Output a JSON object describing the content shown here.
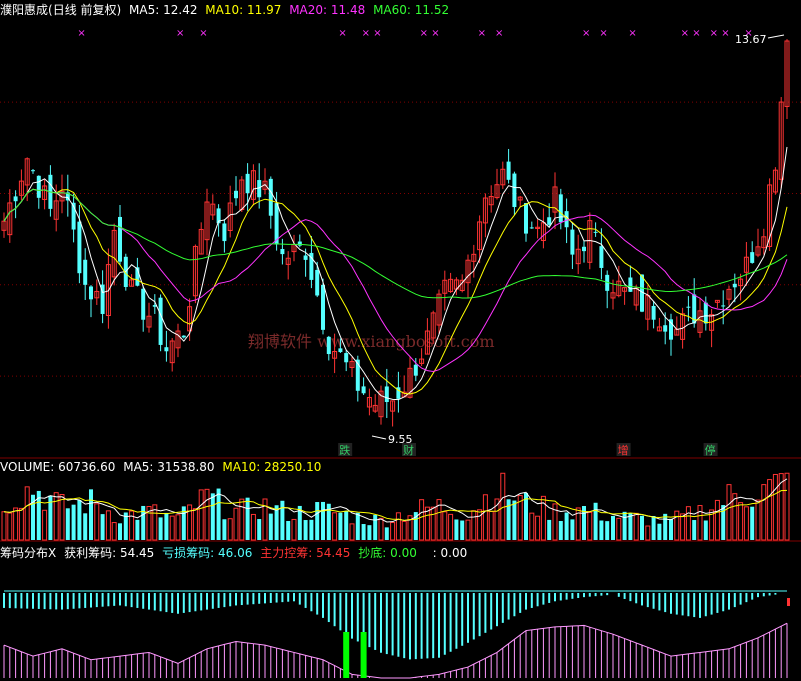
{
  "header": {
    "stock_name": "濮阳惠成",
    "period": "(日线 前复权)",
    "ma5_label": "MA5:",
    "ma5_value": "12.42",
    "ma10_label": "MA10:",
    "ma10_value": "11.97",
    "ma20_label": "MA20:",
    "ma20_value": "11.48",
    "ma60_label": "MA60:",
    "ma60_value": "11.52"
  },
  "volume_header": {
    "label": "VOLUME:",
    "value": "60736.60",
    "ma5_label": "MA5:",
    "ma5_value": "31538.80",
    "ma10_label": "MA10:",
    "ma10_value": "28250.10"
  },
  "chip_header": {
    "label": "筹码分布X",
    "profit_label": "获利筹码:",
    "profit_value": "54.45",
    "loss_label": "亏损筹码:",
    "loss_value": "46.06",
    "control_label": "主力控筹:",
    "control_value": "54.45",
    "bottom_label": "抄底:",
    "bottom_value": "0.00",
    "extra_label": ":",
    "extra_value": "0.00"
  },
  "annotations": {
    "high_price": "13.67",
    "low_price": "9.55",
    "watermark": "翔博软件 www.xiangbosoft.com"
  },
  "signals": [
    {
      "text": "跌",
      "index": 59,
      "color": "#33cc66"
    },
    {
      "text": "财",
      "index": 70,
      "color": "#33cc66"
    },
    {
      "text": "增",
      "index": 107,
      "color": "#ff3333"
    },
    {
      "text": "停",
      "index": 122,
      "color": "#33cc66"
    }
  ],
  "colors": {
    "up": "#ff3333",
    "down": "#55ffff",
    "ma5": "#ffffff",
    "ma10": "#ffff00",
    "ma20": "#ff33ff",
    "ma60": "#33ff33",
    "grid": "#800000",
    "header_text": "#ffffff",
    "ma10_text": "#ffff00",
    "ma20_text": "#ff33ff",
    "ma60_text": "#33ff33",
    "chip_label": "#ffffff",
    "profit": "#ffffff",
    "loss": "#55ffff",
    "control": "#ff3333",
    "bottom": "#33ff33",
    "chip_cyan": "#55ffff",
    "chip_pink": "#ff99ff",
    "chip_green": "#00ff00"
  },
  "chart_data": {
    "type": "candlestick",
    "price_range": [
      9.3,
      13.9
    ],
    "close_anchors": [
      [
        0,
        11.7
      ],
      [
        4,
        12.4
      ],
      [
        8,
        11.8
      ],
      [
        10,
        12.1
      ],
      [
        14,
        11.0
      ],
      [
        17,
        10.8
      ],
      [
        19,
        11.6
      ],
      [
        22,
        10.9
      ],
      [
        26,
        10.6
      ],
      [
        28,
        10.3
      ],
      [
        31,
        10.5
      ],
      [
        35,
        12.0
      ],
      [
        38,
        11.6
      ],
      [
        41,
        12.2
      ],
      [
        45,
        12.0
      ],
      [
        48,
        11.3
      ],
      [
        52,
        11.4
      ],
      [
        56,
        10.4
      ],
      [
        59,
        10.1
      ],
      [
        61,
        9.9
      ],
      [
        64,
        9.7
      ],
      [
        67,
        9.75
      ],
      [
        70,
        10.0
      ],
      [
        73,
        10.4
      ],
      [
        76,
        10.9
      ],
      [
        79,
        11.0
      ],
      [
        83,
        12.0
      ],
      [
        86,
        12.2
      ],
      [
        89,
        11.8
      ],
      [
        92,
        11.6
      ],
      [
        95,
        11.9
      ],
      [
        98,
        11.3
      ],
      [
        101,
        11.6
      ],
      [
        104,
        11.1
      ],
      [
        107,
        10.9
      ],
      [
        110,
        10.8
      ],
      [
        113,
        10.7
      ],
      [
        116,
        10.5
      ],
      [
        119,
        10.7
      ],
      [
        122,
        10.75
      ],
      [
        125,
        11.0
      ],
      [
        128,
        11.2
      ],
      [
        131,
        11.7
      ],
      [
        133,
        12.4
      ],
      [
        135,
        13.67
      ]
    ],
    "volume_anchors": [
      [
        0,
        40
      ],
      [
        5,
        55
      ],
      [
        10,
        35
      ],
      [
        15,
        40
      ],
      [
        20,
        25
      ],
      [
        25,
        30
      ],
      [
        30,
        22
      ],
      [
        35,
        45
      ],
      [
        40,
        30
      ],
      [
        45,
        35
      ],
      [
        50,
        28
      ],
      [
        55,
        32
      ],
      [
        60,
        25
      ],
      [
        65,
        20
      ],
      [
        70,
        30
      ],
      [
        75,
        35
      ],
      [
        80,
        28
      ],
      [
        85,
        55
      ],
      [
        90,
        38
      ],
      [
        95,
        30
      ],
      [
        100,
        32
      ],
      [
        105,
        25
      ],
      [
        110,
        22
      ],
      [
        115,
        20
      ],
      [
        120,
        30
      ],
      [
        125,
        45
      ],
      [
        130,
        50
      ],
      [
        135,
        60.7
      ]
    ],
    "chip_cyan_anchors": [
      [
        0,
        0.18
      ],
      [
        10,
        0.2
      ],
      [
        20,
        0.15
      ],
      [
        30,
        0.25
      ],
      [
        40,
        0.15
      ],
      [
        50,
        0.1
      ],
      [
        55,
        0.3
      ],
      [
        60,
        0.55
      ],
      [
        65,
        0.72
      ],
      [
        70,
        0.8
      ],
      [
        75,
        0.78
      ],
      [
        80,
        0.6
      ],
      [
        85,
        0.4
      ],
      [
        90,
        0.2
      ],
      [
        95,
        0.1
      ],
      [
        100,
        0.05
      ],
      [
        105,
        0.02
      ],
      [
        110,
        0.15
      ],
      [
        115,
        0.25
      ],
      [
        120,
        0.3
      ],
      [
        125,
        0.2
      ],
      [
        130,
        0.05
      ],
      [
        135,
        0.0
      ]
    ],
    "chip_pink_anchors": [
      [
        0,
        0.45
      ],
      [
        5,
        0.3
      ],
      [
        10,
        0.4
      ],
      [
        15,
        0.25
      ],
      [
        20,
        0.3
      ],
      [
        25,
        0.35
      ],
      [
        30,
        0.2
      ],
      [
        35,
        0.4
      ],
      [
        40,
        0.5
      ],
      [
        45,
        0.45
      ],
      [
        50,
        0.35
      ],
      [
        55,
        0.25
      ],
      [
        60,
        0.05
      ],
      [
        65,
        0.0
      ],
      [
        70,
        0.0
      ],
      [
        75,
        0.05
      ],
      [
        80,
        0.15
      ],
      [
        85,
        0.35
      ],
      [
        90,
        0.65
      ],
      [
        95,
        0.7
      ],
      [
        100,
        0.72
      ],
      [
        105,
        0.6
      ],
      [
        110,
        0.45
      ],
      [
        115,
        0.3
      ],
      [
        120,
        0.35
      ],
      [
        125,
        0.4
      ],
      [
        130,
        0.55
      ],
      [
        135,
        0.75
      ]
    ],
    "chip_green_bars": [
      59,
      62
    ],
    "bar_count": 136
  }
}
